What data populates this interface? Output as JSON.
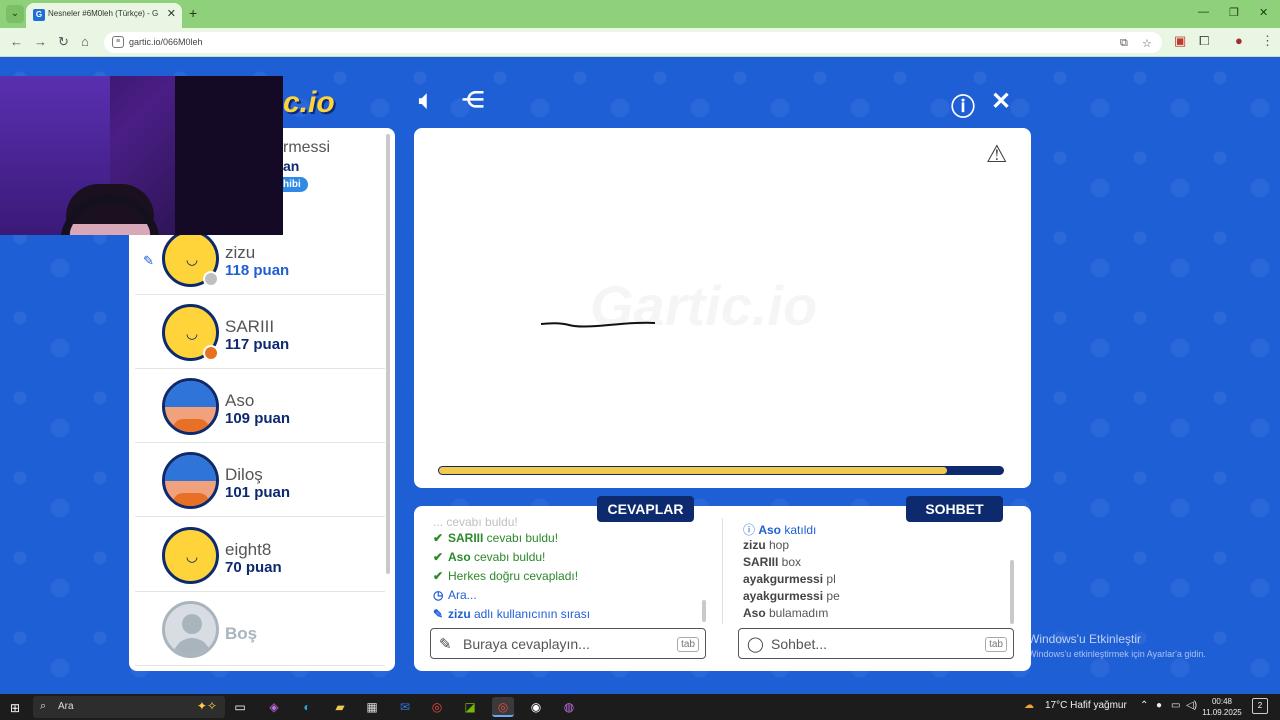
{
  "browser": {
    "tab_title": "Nesneler #6M0leh (Türkçe) - G",
    "url": "gartic.io/066M0leh",
    "tab_close": "✕",
    "new_tab": "+",
    "minimize": "—",
    "restore": "❐",
    "close": "✕"
  },
  "game": {
    "logo": "c.io",
    "watermark": "Gartic.io"
  },
  "partial_player": {
    "name": "rmessi",
    "score": "an",
    "badge": "hibi"
  },
  "players": [
    {
      "name": "zizu",
      "score": "118 puan",
      "avatar": "yellow",
      "status_color": "#bfbfbf",
      "drawing": true
    },
    {
      "name": "SARIII",
      "score": "117 puan",
      "avatar": "yellow",
      "status_color": "#e8701f",
      "drawing": false
    },
    {
      "name": "Aso",
      "score": "109 puan",
      "avatar": "blue",
      "status_color": "",
      "drawing": false
    },
    {
      "name": "Diloş",
      "score": "101 puan",
      "avatar": "blue",
      "status_color": "",
      "drawing": false
    },
    {
      "name": "eight8",
      "score": "70 puan",
      "avatar": "yellow",
      "status_color": "",
      "drawing": false
    },
    {
      "name": "Boş",
      "score": "",
      "avatar": "empty",
      "status_color": "",
      "drawing": false
    }
  ],
  "timer": {
    "progress": 0.9
  },
  "answers": {
    "label": "CEVAPLAR",
    "faded_line": "... cevabı buldu!",
    "lines": [
      {
        "mark": "✔",
        "name": "SARIII",
        "text": " cevabı buldu!",
        "style": "green"
      },
      {
        "mark": "✔",
        "name": "Aso",
        "text": " cevabı buldu!",
        "style": "green"
      },
      {
        "mark": "✔",
        "name": "",
        "text": "Herkes doğru cevapladı!",
        "style": "green"
      },
      {
        "mark": "◷",
        "name": "",
        "text": "Ara...",
        "style": "blue"
      },
      {
        "mark": "✎",
        "name": "zizu",
        "text": " adlı kullanıcının sırası",
        "style": "blue"
      }
    ],
    "placeholder": "Buraya cevaplayın...",
    "tab_hint": "tab"
  },
  "chat": {
    "label": "SOHBET",
    "lines": [
      {
        "name": "Aso",
        "text": " katıldı",
        "style": "blue",
        "mark": "ⓘ "
      },
      {
        "name": "zizu",
        "text": " hop",
        "style": "",
        "mark": ""
      },
      {
        "name": "SARIII",
        "text": " box",
        "style": "",
        "mark": ""
      },
      {
        "name": "ayakgurmessi",
        "text": " pl",
        "style": "",
        "mark": ""
      },
      {
        "name": "ayakgurmessi",
        "text": " pe",
        "style": "",
        "mark": ""
      },
      {
        "name": "Aso",
        "text": " bulamadım",
        "style": "",
        "mark": ""
      }
    ],
    "placeholder": "Sohbet...",
    "tab_hint": "tab"
  },
  "windows": {
    "activate_title": "Windows'u Etkinleştir",
    "activate_sub": "Windows'u etkinleştirmek için Ayarlar'a gidin."
  },
  "taskbar": {
    "search_label": "Ara",
    "weather": "17°C  Hafif yağmur",
    "time": "00:48",
    "date": "11.09.2025",
    "notifications": "2"
  }
}
